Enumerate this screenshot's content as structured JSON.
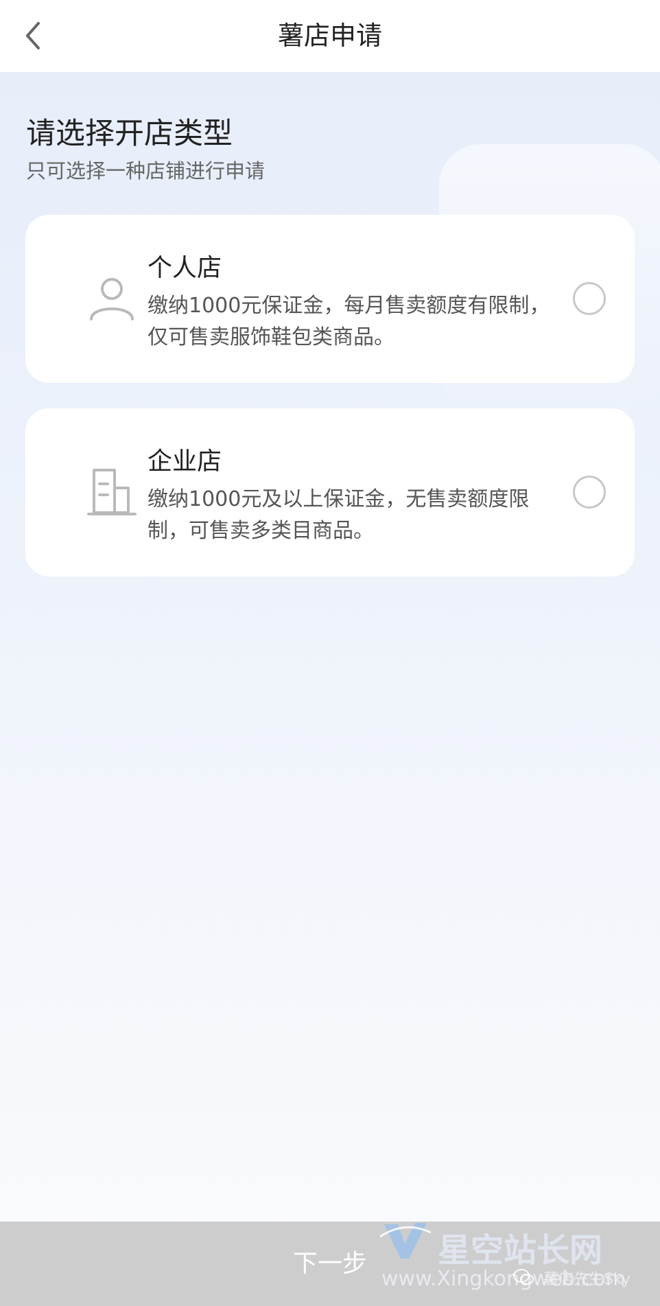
{
  "header": {
    "title": "薯店申请",
    "back_icon": "chevron-left-icon"
  },
  "intro": {
    "heading": "请选择开店类型",
    "subheading": "只可选择一种店铺进行申请"
  },
  "options": [
    {
      "title": "个人店",
      "description": "缴纳1000元保证金，每月售卖额度有限制，仅可售卖服饰鞋包类商品。",
      "icon": "person-icon",
      "selected": false
    },
    {
      "title": "企业店",
      "description": "缴纳1000元及以上保证金，无售卖额度限制，可售卖多类目商品。",
      "icon": "building-icon",
      "selected": false
    }
  ],
  "footer": {
    "next_label": "下一步"
  },
  "watermark": {
    "site_name": "星空站长网",
    "url": "www.Xingkongweb.com",
    "account": "薯店先生Sky"
  },
  "colors": {
    "background": "#e6edfa",
    "card": "#ffffff",
    "button_disabled": "#cdcdcd",
    "radio_border": "#c8c8c8",
    "icon_gray": "#b9b9b9"
  }
}
